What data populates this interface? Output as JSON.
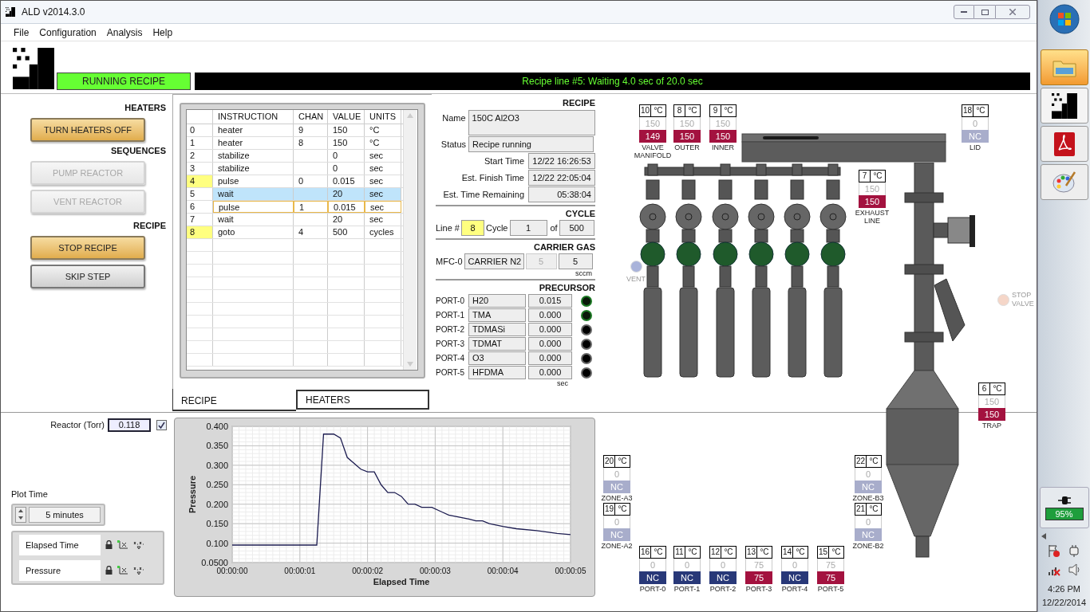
{
  "window": {
    "title": "ALD v2014.3.0"
  },
  "menu": [
    "File",
    "Configuration",
    "Analysis",
    "Help"
  ],
  "header": {
    "mode": "RUNNING RECIPE",
    "message": "Recipe line #5: Waiting 4.0 sec of 20.0 sec"
  },
  "control_sections": [
    {
      "title": "HEATERS",
      "buttons": [
        {
          "label": "TURN HEATERS OFF",
          "highlighted": true,
          "disabled": false
        }
      ]
    },
    {
      "title": "SEQUENCES",
      "buttons": [
        {
          "label": "PUMP REACTOR",
          "highlighted": false,
          "disabled": true
        },
        {
          "label": "VENT REACTOR",
          "highlighted": false,
          "disabled": true
        }
      ]
    },
    {
      "title": "RECIPE",
      "buttons": [
        {
          "label": "STOP RECIPE",
          "highlighted": true,
          "disabled": false
        },
        {
          "label": "SKIP STEP",
          "highlighted": false,
          "disabled": false
        }
      ]
    }
  ],
  "recipe_table": {
    "columns": [
      "INSTRUCTION",
      "CHAN",
      "VALUE",
      "UNITS"
    ],
    "rows": [
      {
        "line": "0",
        "instruction": "heater",
        "chan": "9",
        "value": "150",
        "units": "°C",
        "marked": false,
        "selected": false,
        "current": false
      },
      {
        "line": "1",
        "instruction": "heater",
        "chan": "8",
        "value": "150",
        "units": "°C",
        "marked": false,
        "selected": false,
        "current": false
      },
      {
        "line": "2",
        "instruction": "stabilize",
        "value": "0",
        "units": "sec",
        "marked": false,
        "selected": false,
        "current": false
      },
      {
        "line": "3",
        "instruction": "stabilize",
        "value": "0",
        "units": "sec",
        "marked": false,
        "selected": false,
        "current": false
      },
      {
        "line": "4",
        "instruction": "pulse",
        "chan": "0",
        "value": "0.015",
        "units": "sec",
        "marked": true,
        "selected": false,
        "current": false
      },
      {
        "line": "5",
        "instruction": "wait",
        "value": "20",
        "units": "sec",
        "marked": false,
        "selected": true,
        "current": false
      },
      {
        "line": "6",
        "instruction": "pulse",
        "chan": "1",
        "value": "0.015",
        "units": "sec",
        "marked": false,
        "selected": false,
        "current": true
      },
      {
        "line": "7",
        "instruction": "wait",
        "value": "20",
        "units": "sec",
        "marked": false,
        "selected": false,
        "current": false
      },
      {
        "line": "8",
        "instruction": "goto",
        "chan": "4",
        "value": "500",
        "units": "cycles",
        "marked": true,
        "selected": false,
        "current": false
      }
    ]
  },
  "tabs": [
    {
      "label": "RECIPE",
      "selected": true
    },
    {
      "label": "HEATERS",
      "selected": false
    }
  ],
  "recipe_info": {
    "title": "RECIPE",
    "name_label": "Name",
    "name": "150C Al2O3",
    "status_label": "Status",
    "status": "Recipe running",
    "times": [
      {
        "label": "Start Time",
        "value": "12/22 16:26:53"
      },
      {
        "label": "Est. Finish Time",
        "value": "12/22 22:05:04"
      },
      {
        "label": "Est. Time Remaining",
        "value": "05:38:04"
      }
    ]
  },
  "cycle": {
    "title": "CYCLE",
    "line_label": "Line #",
    "line": "8",
    "cycle_label": "Cycle",
    "cycle": "1",
    "of_label": "of",
    "total": "500"
  },
  "carrier_gas": {
    "title": "CARRIER GAS",
    "label": "MFC-0",
    "gas": "CARRIER N2",
    "setpoint": "5",
    "reading": "5",
    "unit": "sccm"
  },
  "precursor": {
    "title": "PRECURSOR",
    "unit": "sec",
    "ports": [
      {
        "label": "PORT-0",
        "name": "H20",
        "value": "0.015",
        "on": true
      },
      {
        "label": "PORT-1",
        "name": "TMA",
        "value": "0.000",
        "on": true
      },
      {
        "label": "PORT-2",
        "name": "TDMASi",
        "value": "0.000",
        "on": false
      },
      {
        "label": "PORT-3",
        "name": "TDMAT",
        "value": "0.000",
        "on": false
      },
      {
        "label": "PORT-4",
        "name": "O3",
        "value": "0.000",
        "on": false
      },
      {
        "label": "PORT-5",
        "name": "HFDMA",
        "value": "0.000",
        "on": false
      }
    ]
  },
  "diagram": {
    "heaters": [
      {
        "channel": "10",
        "unit": "°C",
        "setpoint": "150",
        "reading": "149",
        "label": "VALVE MANIFOLD",
        "color": "#a3123f"
      },
      {
        "channel": "8",
        "unit": "°C",
        "setpoint": "150",
        "reading": "150",
        "label": "OUTER",
        "color": "#a3123f"
      },
      {
        "channel": "9",
        "unit": "°C",
        "setpoint": "150",
        "reading": "150",
        "label": "INNER",
        "color": "#a3123f"
      },
      {
        "channel": "18",
        "unit": "°C",
        "setpoint": "0",
        "reading": "NC",
        "label": "LID",
        "color": "#a8adcb"
      },
      {
        "channel": "7",
        "unit": "°C",
        "setpoint": "150",
        "reading": "150",
        "label": "EXHAUST LINE",
        "color": "#a3123f"
      },
      {
        "channel": "6",
        "unit": "°C",
        "setpoint": "150",
        "reading": "150",
        "label": "TRAP",
        "color": "#a3123f"
      },
      {
        "channel": "20",
        "unit": "°C",
        "setpoint": "0",
        "reading": "NC",
        "label": "ZONE-A3",
        "color": "#a8adcb"
      },
      {
        "channel": "22",
        "unit": "°C",
        "setpoint": "0",
        "reading": "NC",
        "label": "ZONE-B3",
        "color": "#a8adcb"
      },
      {
        "channel": "19",
        "unit": "°C",
        "setpoint": "0",
        "reading": "NC",
        "label": "ZONE-A2",
        "color": "#a8adcb"
      },
      {
        "channel": "21",
        "unit": "°C",
        "setpoint": "0",
        "reading": "NC",
        "label": "ZONE-B2",
        "color": "#a8adcb"
      },
      {
        "channel": "16",
        "unit": "°C",
        "setpoint": "0",
        "reading": "NC",
        "label": "PORT-0",
        "color": "#283878"
      },
      {
        "channel": "11",
        "unit": "°C",
        "setpoint": "0",
        "reading": "NC",
        "label": "PORT-1",
        "color": "#283878"
      },
      {
        "channel": "12",
        "unit": "°C",
        "setpoint": "0",
        "reading": "NC",
        "label": "PORT-2",
        "color": "#283878"
      },
      {
        "channel": "13",
        "unit": "°C",
        "setpoint": "75",
        "reading": "75",
        "label": "PORT-3",
        "color": "#a3123f"
      },
      {
        "channel": "14",
        "unit": "°C",
        "setpoint": "0",
        "reading": "NC",
        "label": "PORT-4",
        "color": "#283878"
      },
      {
        "channel": "15",
        "unit": "°C",
        "setpoint": "75",
        "reading": "75",
        "label": "PORT-5",
        "color": "#a3123f"
      }
    ],
    "indicators": [
      {
        "label": "VENT",
        "color": "#a9b3da"
      },
      {
        "label": "STOP VALVE",
        "color": "#f5d6c8"
      }
    ]
  },
  "reactor": {
    "label": "Reactor (Torr)",
    "value": "0.118",
    "checked": true
  },
  "plot_time": {
    "label": "Plot Time",
    "value": "5 minutes"
  },
  "scales": [
    {
      "name": "Elapsed Time"
    },
    {
      "name": "Pressure"
    }
  ],
  "plot": {
    "chart_data": {
      "type": "line",
      "xlabel": "Elapsed Time",
      "ylabel": "Pressure",
      "x": [
        0,
        1.25,
        1.35,
        1.5,
        1.6,
        1.7,
        1.9,
        2.0,
        2.1,
        2.2,
        2.3,
        2.4,
        2.5,
        2.6,
        2.7,
        2.8,
        2.95,
        3.1,
        3.2,
        3.5,
        3.6,
        3.7,
        3.8,
        4.0,
        4.2,
        4.5,
        4.8,
        5.0
      ],
      "grid": true,
      "series": [
        {
          "color": "#1c1c50",
          "values": [
            0.095,
            0.095,
            0.38,
            0.38,
            0.37,
            0.32,
            0.29,
            0.283,
            0.283,
            0.25,
            0.23,
            0.23,
            0.22,
            0.2,
            0.2,
            0.192,
            0.192,
            0.18,
            0.172,
            0.162,
            0.157,
            0.157,
            0.15,
            0.143,
            0.137,
            0.132,
            0.125,
            0.122
          ]
        }
      ],
      "xlim": [
        0,
        5
      ],
      "ylim": [
        0.05,
        0.4
      ],
      "xticks": [
        {
          "value": 0,
          "label": "00:00:00"
        },
        {
          "value": 1,
          "label": "00:00:01"
        },
        {
          "value": 2,
          "label": "00:00:02"
        },
        {
          "value": 3,
          "label": "00:00:03"
        },
        {
          "value": 4,
          "label": "00:00:04"
        },
        {
          "value": 5,
          "label": "00:00:05"
        }
      ],
      "yticks": [
        {
          "value": 0.05,
          "label": "0.0500"
        },
        {
          "value": 0.1,
          "label": "0.100"
        },
        {
          "value": 0.15,
          "label": "0.150"
        },
        {
          "value": 0.2,
          "label": "0.200"
        },
        {
          "value": 0.25,
          "label": "0.250"
        },
        {
          "value": 0.3,
          "label": "0.300"
        },
        {
          "value": 0.35,
          "label": "0.350"
        },
        {
          "value": 0.4,
          "label": "0.400"
        }
      ]
    }
  },
  "taskbar": {
    "battery": "95%",
    "time": "4:26 PM",
    "date": "12/22/2014"
  }
}
